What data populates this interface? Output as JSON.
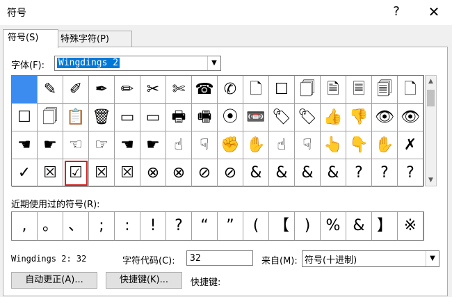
{
  "window": {
    "title": "符号",
    "help": "?",
    "close": "✕"
  },
  "tabs": [
    {
      "label": "符号(S)"
    },
    {
      "label": "特殊字符(P)"
    }
  ],
  "font": {
    "label": "字体(F):",
    "value": "Wingdings 2"
  },
  "symbol_grid": {
    "selected_index": 0,
    "highlighted_index": 50,
    "rows": [
      [
        "",
        "✎",
        "✐",
        "✒",
        "✏",
        "✂",
        "✄",
        "☎",
        "✆",
        "🗋",
        "☐",
        "🗍",
        "🗎",
        "🗏",
        "🗐",
        "🗋"
      ],
      [
        "☐",
        "🗍",
        "📋",
        "🗑",
        "▭",
        "▭",
        "🖶",
        "🖷",
        "⦿",
        "📼",
        "🏷",
        "🏷",
        "👍",
        "👎",
        "👁",
        "👁"
      ],
      [
        "☚",
        "☛",
        "☜",
        "☞",
        "☚",
        "☛",
        "☝",
        "☟",
        "✊",
        "✋",
        "☝",
        "☟",
        "👆",
        "👇",
        "✋",
        "✗"
      ],
      [
        "✓",
        "☒",
        "☑",
        "☒",
        "☒",
        "⊗",
        "⊗",
        "⊘",
        "⊘",
        "&",
        "&",
        "&",
        "&",
        "?",
        "?",
        "?"
      ]
    ]
  },
  "recent": {
    "label": "近期使用过的符号(R):",
    "symbols": [
      ",",
      "。",
      "、",
      ";",
      ":",
      "!",
      "?",
      "“",
      "”",
      "(",
      "【",
      ")",
      "%",
      "&",
      "】",
      "※"
    ]
  },
  "info": {
    "char_name": "Wingdings 2: 32",
    "char_code_label": "字符代码(C):",
    "char_code_value": "32",
    "from_label": "来自(M):",
    "from_value": "符号(十进制)"
  },
  "buttons": {
    "autocorrect": "自动更正(A)...",
    "shortcut_key": "快捷键(K)...",
    "shortcut_label": "快捷键:"
  }
}
